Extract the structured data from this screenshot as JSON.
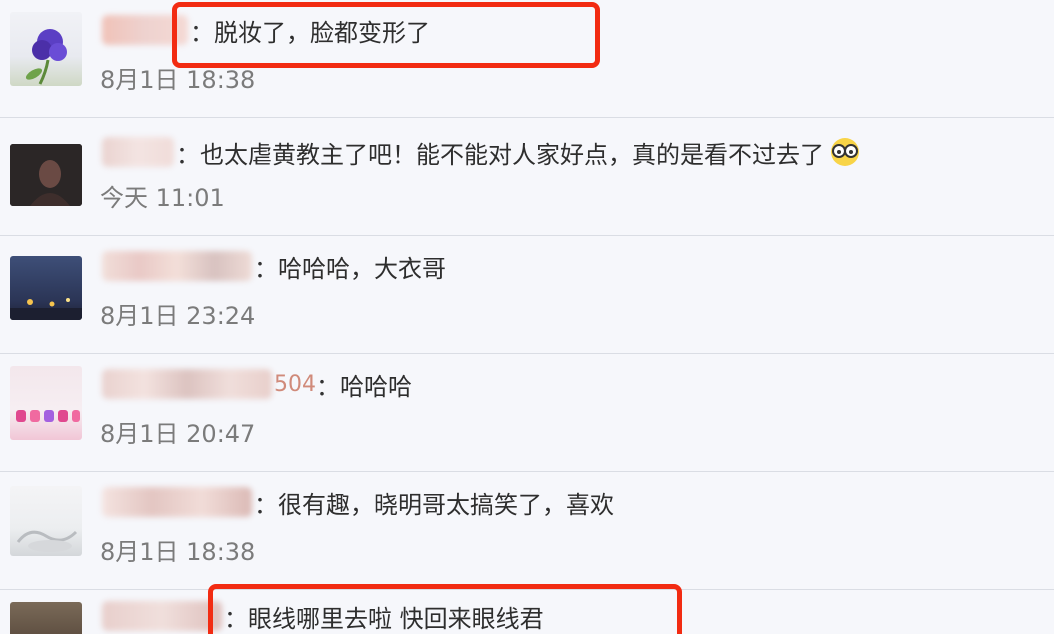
{
  "comments": [
    {
      "name_fragment": "",
      "separator": "：",
      "text": "脱妆了，脸都变形了",
      "time": "8月1日 18:38"
    },
    {
      "name_fragment": "",
      "separator": "：",
      "text": "也太虐黄教主了吧！能不能对人家好点，真的是看不过去了",
      "time": "今天 11:01",
      "emoji_icon": "glasses-face-emoji"
    },
    {
      "name_fragment": "",
      "separator": "：",
      "text": "哈哈哈，大衣哥",
      "time": "8月1日 23:24"
    },
    {
      "name_fragment": "504",
      "separator": "：",
      "text": "哈哈哈",
      "time": "8月1日 20:47"
    },
    {
      "name_fragment": "",
      "separator": "：",
      "text": "很有趣，晓明哥太搞笑了，喜欢",
      "time": "8月1日 18:38"
    },
    {
      "name_fragment": "",
      "separator": "：",
      "text": "眼线哪里去啦 快回来眼线君",
      "time": ""
    }
  ],
  "colors": {
    "highlight": "#f22b12",
    "background": "#f6f7fb",
    "timestamp": "#7b7b7b"
  }
}
